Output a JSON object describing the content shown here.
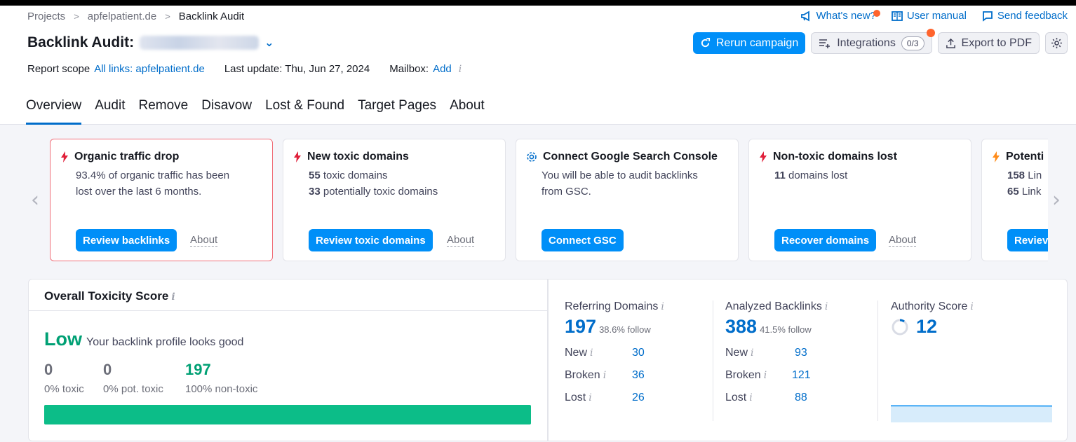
{
  "breadcrumb": [
    "Projects",
    "apfelpatient.de",
    "Backlink Audit"
  ],
  "top_links": {
    "whats_new": "What's new?",
    "user_manual": "User manual",
    "send_feedback": "Send feedback"
  },
  "title": {
    "prefix": "Backlink Audit:"
  },
  "actions": {
    "rerun": "Rerun campaign",
    "integrations": "Integrations",
    "integrations_count": "0/3",
    "export": "Export to PDF"
  },
  "scope": {
    "report_scope_label": "Report scope",
    "report_scope_link": "All links: apfelpatient.de",
    "last_update": "Last update: Thu, Jun 27, 2024",
    "mailbox_label": "Mailbox:",
    "mailbox_link": "Add"
  },
  "tabs": [
    "Overview",
    "Audit",
    "Remove",
    "Disavow",
    "Lost & Found",
    "Target Pages",
    "About"
  ],
  "cards": [
    {
      "title": "Organic traffic drop",
      "line1": "93.4% of organic traffic has been",
      "line2": "lost over the last 6 months.",
      "button": "Review backlinks",
      "about": "About"
    },
    {
      "title": "New toxic domains",
      "n1": "55",
      "t1": " toxic domains",
      "n2": "33",
      "t2": " potentially toxic domains",
      "button": "Review toxic domains",
      "about": "About"
    },
    {
      "title": "Connect Google Search Console",
      "line1": "You will be able to audit backlinks",
      "line2": "from GSC.",
      "button": "Connect GSC"
    },
    {
      "title": "Non-toxic domains lost",
      "n1": "11",
      "t1": " domains lost",
      "button": "Recover domains",
      "about": "About"
    },
    {
      "title": "Potenti",
      "n1": "158",
      "t1": " Lin",
      "n2": "65",
      "t2": " Link",
      "button": "Reviev"
    }
  ],
  "toxicity": {
    "title": "Overall Toxicity Score",
    "level": "Low",
    "message": "Your backlink profile looks good",
    "toxic": "0",
    "toxic_label": "0% toxic",
    "pot_toxic": "0",
    "pot_toxic_label": "0% pot. toxic",
    "non_toxic": "197",
    "non_toxic_label": "100% non-toxic",
    "non_toxic_fraction": 1.0
  },
  "referring_domains": {
    "label": "Referring Domains",
    "value": "197",
    "follow": "38.6% follow",
    "new_label": "New",
    "new": "30",
    "broken_label": "Broken",
    "broken": "36",
    "lost_label": "Lost",
    "lost": "26"
  },
  "analyzed_backlinks": {
    "label": "Analyzed Backlinks",
    "value": "388",
    "follow": "41.5% follow",
    "new_label": "New",
    "new": "93",
    "broken_label": "Broken",
    "broken": "121",
    "lost_label": "Lost",
    "lost": "88"
  },
  "authority_score": {
    "label": "Authority Score",
    "value": "12",
    "trend": [
      12,
      12,
      11,
      11,
      11,
      10,
      10,
      10,
      9
    ]
  },
  "colors": {
    "primary": "#008ff8",
    "link": "#006dca",
    "green": "#00a074",
    "bar": "#0cbd88",
    "alert": "#e0213b",
    "orange": "#ff642d"
  }
}
